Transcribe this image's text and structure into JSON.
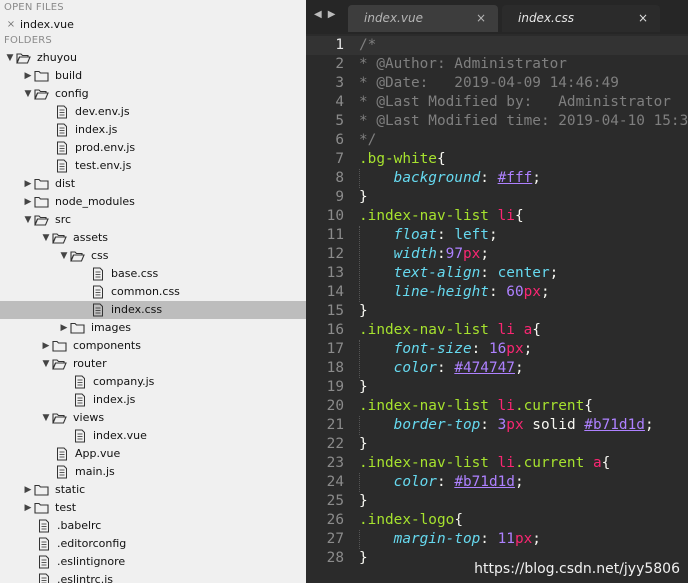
{
  "sidebar": {
    "open_files_header": "OPEN FILES",
    "open_files": [
      {
        "label": "index.vue"
      }
    ],
    "folders_header": "FOLDERS",
    "tree": [
      {
        "label": "zhuyou",
        "type": "folder",
        "depth": 0,
        "expanded": true
      },
      {
        "label": "build",
        "type": "folder",
        "depth": 1,
        "expanded": false
      },
      {
        "label": "config",
        "type": "folder",
        "depth": 1,
        "expanded": true
      },
      {
        "label": "dev.env.js",
        "type": "file",
        "depth": 2
      },
      {
        "label": "index.js",
        "type": "file",
        "depth": 2
      },
      {
        "label": "prod.env.js",
        "type": "file",
        "depth": 2
      },
      {
        "label": "test.env.js",
        "type": "file",
        "depth": 2
      },
      {
        "label": "dist",
        "type": "folder",
        "depth": 1,
        "expanded": false
      },
      {
        "label": "node_modules",
        "type": "folder",
        "depth": 1,
        "expanded": false
      },
      {
        "label": "src",
        "type": "folder",
        "depth": 1,
        "expanded": true
      },
      {
        "label": "assets",
        "type": "folder",
        "depth": 2,
        "expanded": true
      },
      {
        "label": "css",
        "type": "folder",
        "depth": 3,
        "expanded": true
      },
      {
        "label": "base.css",
        "type": "file",
        "depth": 4
      },
      {
        "label": "common.css",
        "type": "file",
        "depth": 4
      },
      {
        "label": "index.css",
        "type": "file",
        "depth": 4,
        "selected": true
      },
      {
        "label": "images",
        "type": "folder",
        "depth": 3,
        "expanded": false
      },
      {
        "label": "components",
        "type": "folder",
        "depth": 2,
        "expanded": false
      },
      {
        "label": "router",
        "type": "folder",
        "depth": 2,
        "expanded": true
      },
      {
        "label": "company.js",
        "type": "file",
        "depth": 3
      },
      {
        "label": "index.js",
        "type": "file",
        "depth": 3
      },
      {
        "label": "views",
        "type": "folder",
        "depth": 2,
        "expanded": true
      },
      {
        "label": "index.vue",
        "type": "file",
        "depth": 3
      },
      {
        "label": "App.vue",
        "type": "file",
        "depth": 2
      },
      {
        "label": "main.js",
        "type": "file",
        "depth": 2
      },
      {
        "label": "static",
        "type": "folder",
        "depth": 1,
        "expanded": false
      },
      {
        "label": "test",
        "type": "folder",
        "depth": 1,
        "expanded": false
      },
      {
        "label": ".babelrc",
        "type": "file",
        "depth": 1
      },
      {
        "label": ".editorconfig",
        "type": "file",
        "depth": 1
      },
      {
        "label": ".eslintignore",
        "type": "file",
        "depth": 1
      },
      {
        "label": ".eslintrc.js",
        "type": "file",
        "depth": 1
      }
    ]
  },
  "tabs": {
    "nav_back_icon": "triangle-left",
    "nav_forward_icon": "triangle-right",
    "items": [
      {
        "label": "index.vue",
        "active": false,
        "close": "×"
      },
      {
        "label": "index.css",
        "active": true,
        "close": "×"
      }
    ]
  },
  "editor": {
    "current_line": 1,
    "lines": [
      {
        "n": "1",
        "tokens": [
          [
            "cm",
            "/*"
          ]
        ]
      },
      {
        "n": "2",
        "tokens": [
          [
            "cm",
            "* @Author: Administrator"
          ]
        ]
      },
      {
        "n": "3",
        "tokens": [
          [
            "cm",
            "* @Date:   2019-04-09 14:46:49"
          ]
        ]
      },
      {
        "n": "4",
        "tokens": [
          [
            "cm",
            "* @Last Modified by:   Administrator"
          ]
        ]
      },
      {
        "n": "5",
        "tokens": [
          [
            "cm",
            "* @Last Modified time: 2019-04-10 15:3"
          ]
        ]
      },
      {
        "n": "6",
        "tokens": [
          [
            "cm",
            "*/"
          ]
        ]
      },
      {
        "n": "7",
        "tokens": [
          [
            "sel",
            ".bg-white"
          ],
          [
            "punc",
            "{"
          ]
        ]
      },
      {
        "n": "8",
        "tokens": [
          [
            "sp",
            "    "
          ],
          [
            "prop",
            "background"
          ],
          [
            "punc",
            ": "
          ],
          [
            "hexv",
            "#fff"
          ],
          [
            "punc",
            ";"
          ]
        ]
      },
      {
        "n": "9",
        "tokens": [
          [
            "punc",
            "}"
          ]
        ]
      },
      {
        "n": "10",
        "tokens": [
          [
            "sel",
            ".index-nav-list "
          ],
          [
            "tag",
            "li"
          ],
          [
            "punc",
            "{"
          ]
        ]
      },
      {
        "n": "11",
        "tokens": [
          [
            "sp",
            "    "
          ],
          [
            "prop",
            "float"
          ],
          [
            "punc",
            ": "
          ],
          [
            "kw",
            "left"
          ],
          [
            "punc",
            ";"
          ]
        ]
      },
      {
        "n": "12",
        "tokens": [
          [
            "sp",
            "    "
          ],
          [
            "prop",
            "width"
          ],
          [
            "punc",
            ":"
          ],
          [
            "num",
            "97"
          ],
          [
            "unit",
            "px"
          ],
          [
            "punc",
            ";"
          ]
        ]
      },
      {
        "n": "13",
        "tokens": [
          [
            "sp",
            "    "
          ],
          [
            "prop",
            "text-align"
          ],
          [
            "punc",
            ": "
          ],
          [
            "kw",
            "center"
          ],
          [
            "punc",
            ";"
          ]
        ]
      },
      {
        "n": "14",
        "tokens": [
          [
            "sp",
            "    "
          ],
          [
            "prop",
            "line-height"
          ],
          [
            "punc",
            ": "
          ],
          [
            "num",
            "60"
          ],
          [
            "unit",
            "px"
          ],
          [
            "punc",
            ";"
          ]
        ]
      },
      {
        "n": "15",
        "tokens": [
          [
            "punc",
            "}"
          ]
        ]
      },
      {
        "n": "16",
        "tokens": [
          [
            "sel",
            ".index-nav-list "
          ],
          [
            "tag",
            "li a"
          ],
          [
            "punc",
            "{"
          ]
        ]
      },
      {
        "n": "17",
        "tokens": [
          [
            "sp",
            "    "
          ],
          [
            "prop",
            "font-size"
          ],
          [
            "punc",
            ": "
          ],
          [
            "num",
            "16"
          ],
          [
            "unit",
            "px"
          ],
          [
            "punc",
            ";"
          ]
        ]
      },
      {
        "n": "18",
        "tokens": [
          [
            "sp",
            "    "
          ],
          [
            "prop",
            "color"
          ],
          [
            "punc",
            ": "
          ],
          [
            "hexv",
            "#474747"
          ],
          [
            "punc",
            ";"
          ]
        ]
      },
      {
        "n": "19",
        "tokens": [
          [
            "punc",
            "}"
          ]
        ]
      },
      {
        "n": "20",
        "tokens": [
          [
            "sel",
            ".index-nav-list "
          ],
          [
            "tag",
            "li"
          ],
          [
            "sel",
            ".current"
          ],
          [
            "punc",
            "{"
          ]
        ]
      },
      {
        "n": "21",
        "tokens": [
          [
            "sp",
            "    "
          ],
          [
            "prop",
            "border-top"
          ],
          [
            "punc",
            ": "
          ],
          [
            "num",
            "3"
          ],
          [
            "unit",
            "px"
          ],
          [
            "punc",
            " solid "
          ],
          [
            "hexv",
            "#b71d1d"
          ],
          [
            "punc",
            ";"
          ]
        ]
      },
      {
        "n": "22",
        "tokens": [
          [
            "punc",
            "}"
          ]
        ]
      },
      {
        "n": "23",
        "tokens": [
          [
            "sel",
            ".index-nav-list "
          ],
          [
            "tag",
            "li"
          ],
          [
            "sel",
            ".current "
          ],
          [
            "tag",
            "a"
          ],
          [
            "punc",
            "{"
          ]
        ]
      },
      {
        "n": "24",
        "tokens": [
          [
            "sp",
            "    "
          ],
          [
            "prop",
            "color"
          ],
          [
            "punc",
            ": "
          ],
          [
            "hexv",
            "#b71d1d"
          ],
          [
            "punc",
            ";"
          ]
        ]
      },
      {
        "n": "25",
        "tokens": [
          [
            "punc",
            "}"
          ]
        ]
      },
      {
        "n": "26",
        "tokens": [
          [
            "sel",
            ".index-logo"
          ],
          [
            "punc",
            "{"
          ]
        ]
      },
      {
        "n": "27",
        "tokens": [
          [
            "sp",
            "    "
          ],
          [
            "prop",
            "margin-top"
          ],
          [
            "punc",
            ": "
          ],
          [
            "num",
            "11"
          ],
          [
            "unit",
            "px"
          ],
          [
            "punc",
            ";"
          ]
        ]
      },
      {
        "n": "28",
        "tokens": [
          [
            "punc",
            "}"
          ]
        ]
      }
    ]
  },
  "watermark": "https://blog.csdn.net/jyy5806",
  "colors": {
    "sidebar_bg": "#f0f0f0",
    "sidebar_selected": "#bdbdbd",
    "editor_bg": "#2b2b2b",
    "comment": "#7f7f7f",
    "selector": "#a6e22e",
    "property": "#66d9ef",
    "number": "#ae81ff",
    "unit": "#f92672"
  }
}
